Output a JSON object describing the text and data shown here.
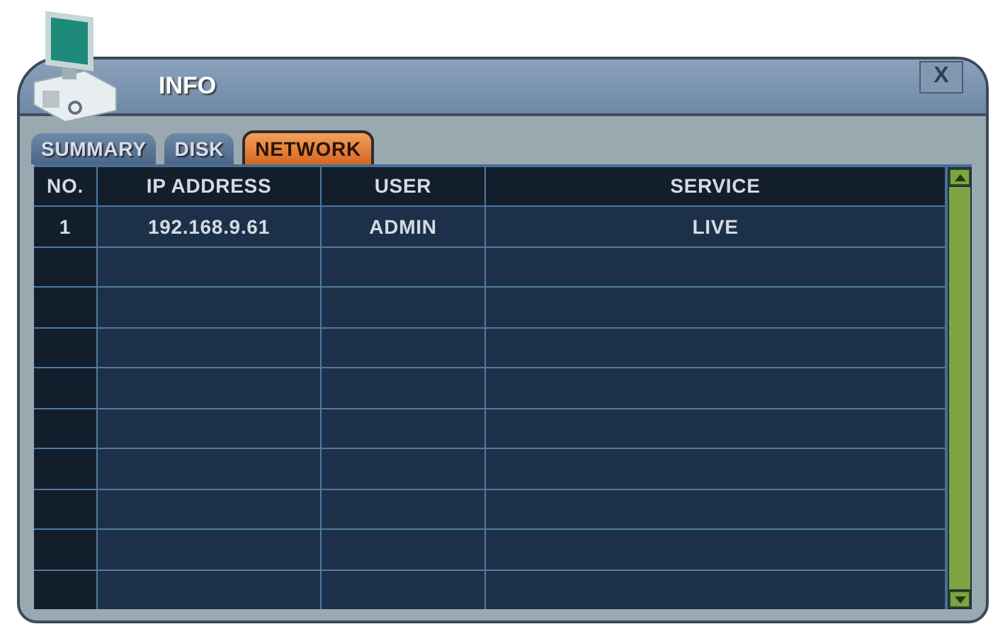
{
  "window": {
    "title": "INFO",
    "close": "X"
  },
  "tabs": [
    {
      "label": "SUMMARY",
      "selected": false
    },
    {
      "label": "DISK",
      "selected": false
    },
    {
      "label": "NETWORK",
      "selected": true
    }
  ],
  "table": {
    "columns": [
      "NO.",
      "IP ADDRESS",
      "USER",
      "SERVICE"
    ],
    "rows": [
      [
        "1",
        "192.168.9.61",
        "ADMIN",
        "LIVE"
      ]
    ]
  }
}
